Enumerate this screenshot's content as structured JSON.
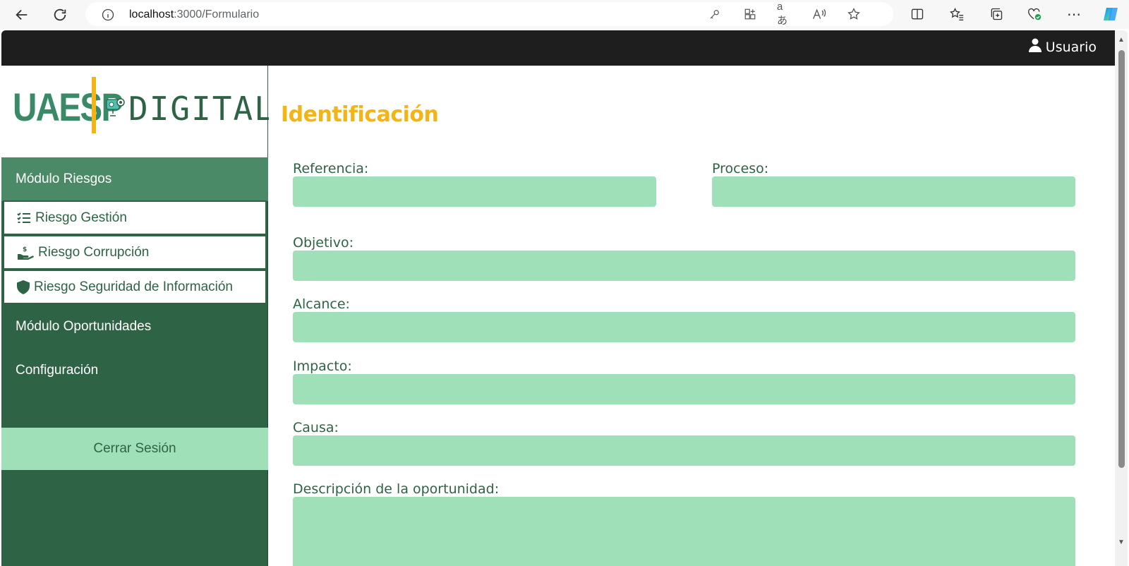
{
  "browser": {
    "url_host": "localhost",
    "url_path": ":3000/Formulario"
  },
  "header": {
    "user_label": "Usuario"
  },
  "logo": {
    "left_text": "UAESP",
    "right_text": "DIGITAL"
  },
  "sidebar": {
    "module_risks": "Módulo Riesgos",
    "sub_items": [
      {
        "label": "Riesgo Gestión",
        "icon": "checklist-icon"
      },
      {
        "label": "Riesgo Corrupción",
        "icon": "hand-coin-icon"
      },
      {
        "label": "Riesgo Seguridad de Información",
        "icon": "shield-icon"
      }
    ],
    "module_opportunities": "Módulo Oportunidades",
    "configuration": "Configuración",
    "logout": "Cerrar Sesión"
  },
  "form": {
    "title": "Identificación",
    "fields": {
      "referencia": {
        "label": "Referencia:",
        "value": ""
      },
      "proceso": {
        "label": "Proceso:",
        "value": ""
      },
      "objetivo": {
        "label": "Objetivo:",
        "value": ""
      },
      "alcance": {
        "label": "Alcance:",
        "value": ""
      },
      "impacto": {
        "label": "Impacto:",
        "value": ""
      },
      "causa": {
        "label": "Causa:",
        "value": ""
      },
      "descripcion": {
        "label": "Descripción de la oportunidad:",
        "value": ""
      }
    }
  },
  "colors": {
    "sidebar_bg": "#2e6346",
    "active_module": "#4a8a66",
    "input_bg": "#a0e0b8",
    "title_accent": "#f3b416",
    "topbar_bg": "#1e1e1e"
  }
}
